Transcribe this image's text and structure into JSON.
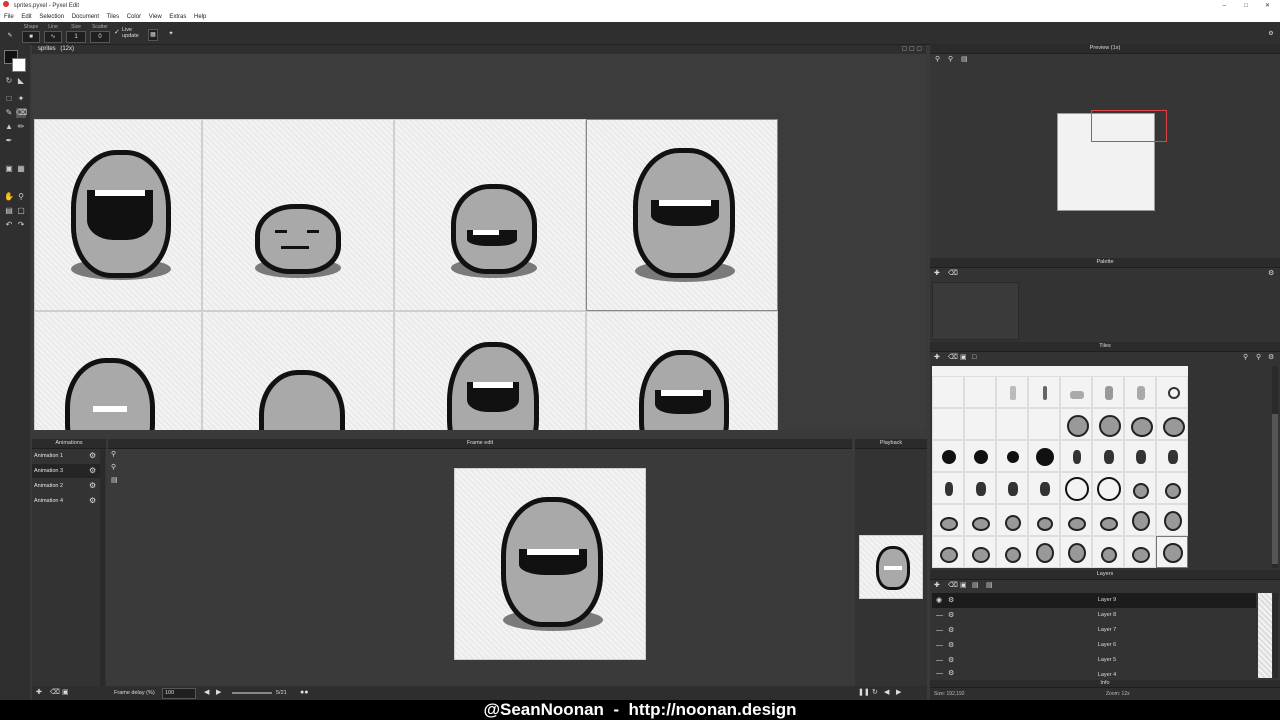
{
  "window": {
    "title": "sprites.pyxel - Pyxel Edit"
  },
  "menu": [
    "File",
    "Edit",
    "Selection",
    "Document",
    "Tiles",
    "Color",
    "View",
    "Extras",
    "Help"
  ],
  "toolbar": {
    "shape_label": "Shape",
    "line_label": "Line",
    "size_label": "Size",
    "size_value": "1",
    "scatter_label": "Scatter",
    "scatter_value": "0",
    "live_update": "Live update"
  },
  "document": {
    "tab": "sprites",
    "zoom": "(12x)"
  },
  "panels": {
    "preview": "Preview (1x)",
    "palette": "Palette",
    "tiles": "Tiles",
    "layers": "Layers",
    "animations": "Animations",
    "frame_edit": "Frame edit",
    "playback": "Playback",
    "info": "Info"
  },
  "animations": [
    "Animation 1",
    "Animation 3",
    "Animation 2",
    "Animation 4"
  ],
  "frame_controls": {
    "delay_label": "Frame delay (%)",
    "delay_value": "100",
    "frame_counter": "5/21"
  },
  "layers": [
    "Layer 9",
    "Layer 8",
    "Layer 7",
    "Layer 6",
    "Layer 5",
    "Layer 4"
  ],
  "info": {
    "size": "Size: 192,192",
    "zoom": "Zoom: 12x"
  },
  "footer": {
    "text": "@SeanNoonan  -  http://noonan.design"
  },
  "colors": {
    "accent": "#2a2a2a",
    "canvas_bg": "#3c3c3c",
    "sprite_gray": "#a9a9a9"
  },
  "icons": [
    "pencil-icon",
    "eraser-icon",
    "zoom-in-icon",
    "zoom-out-icon",
    "gear-icon",
    "play-icon",
    "trash-icon",
    "add-icon",
    "eye-icon"
  ]
}
